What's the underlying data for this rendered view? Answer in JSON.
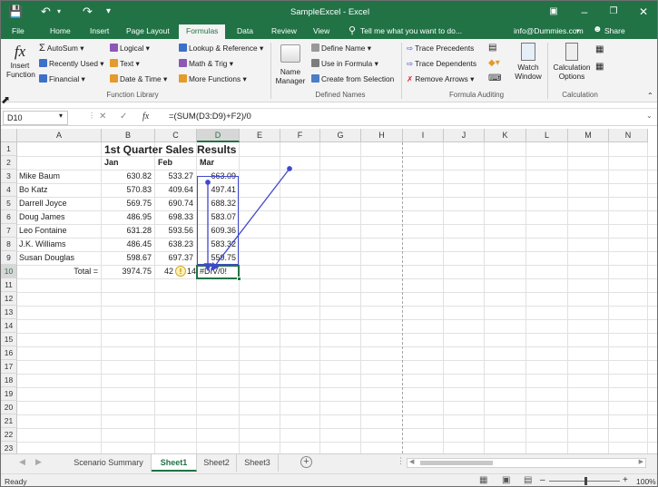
{
  "window": {
    "title": "SampleExcel - Excel"
  },
  "menu": {
    "tabs": [
      "File",
      "Home",
      "Insert",
      "Page Layout",
      "Formulas",
      "Data",
      "Review",
      "View"
    ],
    "active": "Formulas",
    "tell_me": "Tell me what you want to do...",
    "account": "info@Dummies.com",
    "share": "Share"
  },
  "ribbon": {
    "insert_function": "Insert Function",
    "fx_symbol": "fx",
    "autosum": "AutoSum",
    "recently_used": "Recently Used",
    "financial": "Financial",
    "logical": "Logical",
    "text": "Text",
    "date_time": "Date & Time",
    "lookup": "Lookup & Reference",
    "math_trig": "Math & Trig",
    "more_functions": "More Functions",
    "group_function_library": "Function Library",
    "name_manager": "Name Manager",
    "define_name": "Define Name",
    "use_in_formula": "Use in Formula",
    "create_from_selection": "Create from Selection",
    "group_defined_names": "Defined Names",
    "trace_precedents": "Trace Precedents",
    "trace_dependents": "Trace Dependents",
    "remove_arrows": "Remove Arrows",
    "group_formula_auditing": "Formula Auditing",
    "watch_window": "Watch Window",
    "calc_options": "Calculation Options",
    "group_calculation": "Calculation"
  },
  "formula_bar": {
    "name_box": "D10",
    "fx": "fx",
    "formula": "=(SUM(D3:D9)+F2)/0"
  },
  "columns": [
    "A",
    "B",
    "C",
    "D",
    "E",
    "F",
    "G",
    "H",
    "I",
    "J",
    "K",
    "L",
    "M",
    "N"
  ],
  "rows": [
    "1",
    "2",
    "3",
    "4",
    "5",
    "6",
    "7",
    "8",
    "9",
    "10",
    "11",
    "12",
    "13",
    "14",
    "15",
    "16",
    "17",
    "18",
    "19",
    "20",
    "21",
    "22",
    "23"
  ],
  "sheet": {
    "title": "1st Quarter Sales Results",
    "headers": [
      "Jan",
      "Feb",
      "Mar"
    ],
    "data": [
      {
        "name": "Mike Baum",
        "jan": "630.82",
        "feb": "533.27",
        "mar": "663.09"
      },
      {
        "name": "Bo Katz",
        "jan": "570.83",
        "feb": "409.64",
        "mar": "497.41"
      },
      {
        "name": "Darrell Joyce",
        "jan": "569.75",
        "feb": "690.74",
        "mar": "688.32"
      },
      {
        "name": "Doug James",
        "jan": "486.95",
        "feb": "698.33",
        "mar": "583.07"
      },
      {
        "name": "Leo Fontaine",
        "jan": "631.28",
        "feb": "593.56",
        "mar": "609.36"
      },
      {
        "name": "J.K. Williams",
        "jan": "486.45",
        "feb": "638.23",
        "mar": "583.32"
      },
      {
        "name": "Susan Douglas",
        "jan": "598.67",
        "feb": "697.37",
        "mar": "559.75"
      }
    ],
    "total_label": "Total =",
    "total_jan": "3974.75",
    "total_feb": "42",
    "total_feb_tail": "14",
    "total_mar": "#DIV/0!"
  },
  "sheets": {
    "tabs": [
      "Scenario Summary",
      "Sheet1",
      "Sheet2",
      "Sheet3"
    ],
    "active": "Sheet1"
  },
  "status": {
    "left": "Ready",
    "zoom": "100%"
  },
  "colors": {
    "excel_green": "#217346",
    "trace_blue": "#3f48cc"
  }
}
